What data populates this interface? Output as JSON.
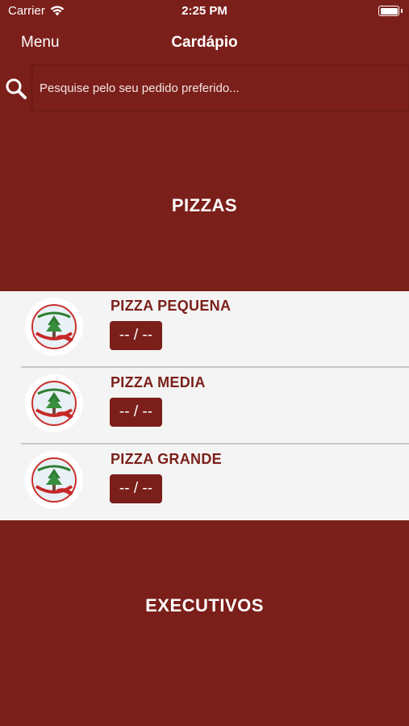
{
  "status_bar": {
    "carrier": "Carrier",
    "time": "2:25 PM"
  },
  "nav": {
    "menu_label": "Menu",
    "title": "Cardápio"
  },
  "search": {
    "placeholder": "Pesquise pelo seu pedido preferido...",
    "value": ""
  },
  "sections": [
    {
      "title": "PIZZAS",
      "items": [
        {
          "name": "PIZZA PEQUENA",
          "price": "-- / --",
          "logo_icon": "restaurant-logo-icon"
        },
        {
          "name": "PIZZA MEDIA",
          "price": "-- / --",
          "logo_icon": "restaurant-logo-icon"
        },
        {
          "name": "PIZZA GRANDE",
          "price": "-- / --",
          "logo_icon": "restaurant-logo-icon"
        }
      ]
    },
    {
      "title": "EXECUTIVOS",
      "items": []
    }
  ],
  "colors": {
    "brand": "#7b1f1a",
    "list_background": "#f4f4f4",
    "divider": "#c8c8c8"
  }
}
